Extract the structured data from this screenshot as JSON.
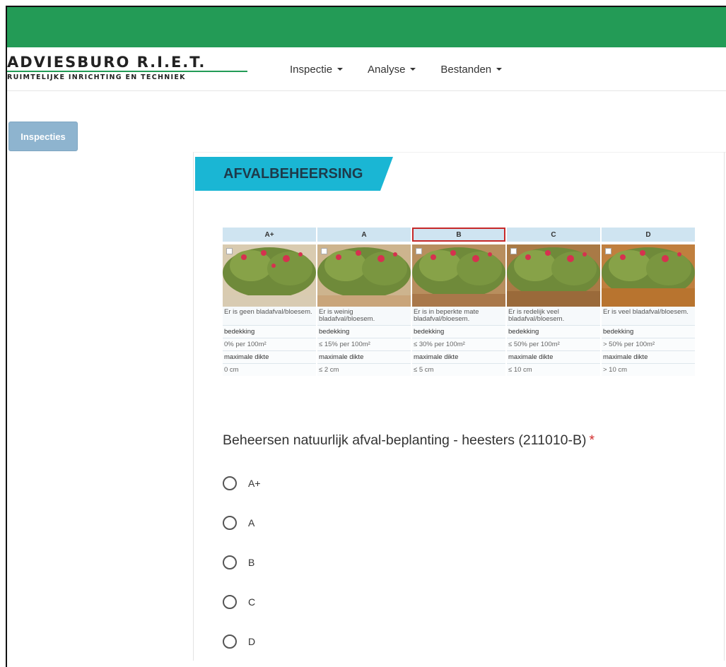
{
  "header": {
    "logo_title": "ADVIESBURO R.I.E.T.",
    "logo_subtitle": "RUIMTELIJKE INRICHTING EN TECHNIEK",
    "menu": [
      {
        "label": "Inspectie"
      },
      {
        "label": "Analyse"
      },
      {
        "label": "Bestanden"
      }
    ]
  },
  "sidebar": {
    "button_label": "Inspecties"
  },
  "section": {
    "title": "AFVALBEHEERSING"
  },
  "reference_table": {
    "selected": "B",
    "columns": [
      {
        "grade": "A+",
        "description": "Er is geen bladafval/bloesem.",
        "coverage_label": "bedekking",
        "coverage": "0% per 100m²",
        "thickness_label": "maximale dikte",
        "thickness": "0 cm"
      },
      {
        "grade": "A",
        "description": "Er is weinig bladafval/bloesem.",
        "coverage_label": "bedekking",
        "coverage": "≤ 15% per 100m²",
        "thickness_label": "maximale dikte",
        "thickness": "≤ 2 cm"
      },
      {
        "grade": "B",
        "description": "Er is in beperkte mate bladafval/bloesem.",
        "coverage_label": "bedekking",
        "coverage": "≤ 30% per 100m²",
        "thickness_label": "maximale dikte",
        "thickness": "≤ 5 cm"
      },
      {
        "grade": "C",
        "description": "Er is redelijk veel bladafval/bloesem.",
        "coverage_label": "bedekking",
        "coverage": "≤ 50% per 100m²",
        "thickness_label": "maximale dikte",
        "thickness": "≤ 10 cm"
      },
      {
        "grade": "D",
        "description": "Er is veel bladafval/bloesem.",
        "coverage_label": "bedekking",
        "coverage": "> 50% per 100m²",
        "thickness_label": "maximale dikte",
        "thickness": "> 10 cm"
      }
    ]
  },
  "question": {
    "text": "Beheersen natuurlijk afval-beplanting - heesters (211010-B)",
    "required_marker": "*",
    "options": [
      {
        "label": "A+"
      },
      {
        "label": "A"
      },
      {
        "label": "B"
      },
      {
        "label": "C"
      },
      {
        "label": "D"
      }
    ]
  },
  "colors": {
    "topbar": "#239b56",
    "banner": "#1ab6d4",
    "sidebar_button": "#8eb4cf",
    "selected_border": "#c62828",
    "required": "#d32f2f"
  }
}
